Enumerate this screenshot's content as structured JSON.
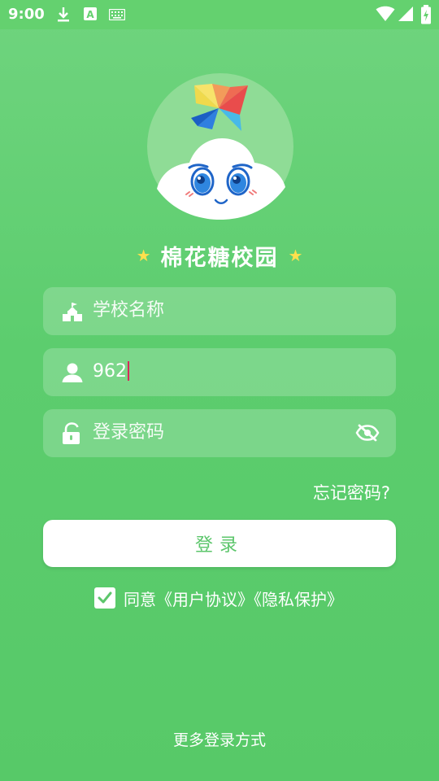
{
  "status_bar": {
    "time": "9:00"
  },
  "app": {
    "title": "棉花糖校园"
  },
  "form": {
    "school_placeholder": "学校名称",
    "username_value": "962",
    "password_placeholder": "登录密码",
    "forgot_label": "忘记密码?",
    "login_label": "登录",
    "agree_prefix": "同意",
    "user_agreement": "《用户协议》",
    "privacy": "《隐私保护》",
    "agree_checked": true
  },
  "footer": {
    "more_login": "更多登录方式"
  },
  "icons": {
    "school": "school-icon",
    "user": "user-icon",
    "lock": "lock-icon",
    "eye_hidden": "eye-off-icon",
    "check": "check-icon"
  },
  "colors": {
    "background": "#5ccd6e",
    "button_text": "#5cc66b",
    "caret": "#d8295a",
    "star": "#ffe04d"
  }
}
